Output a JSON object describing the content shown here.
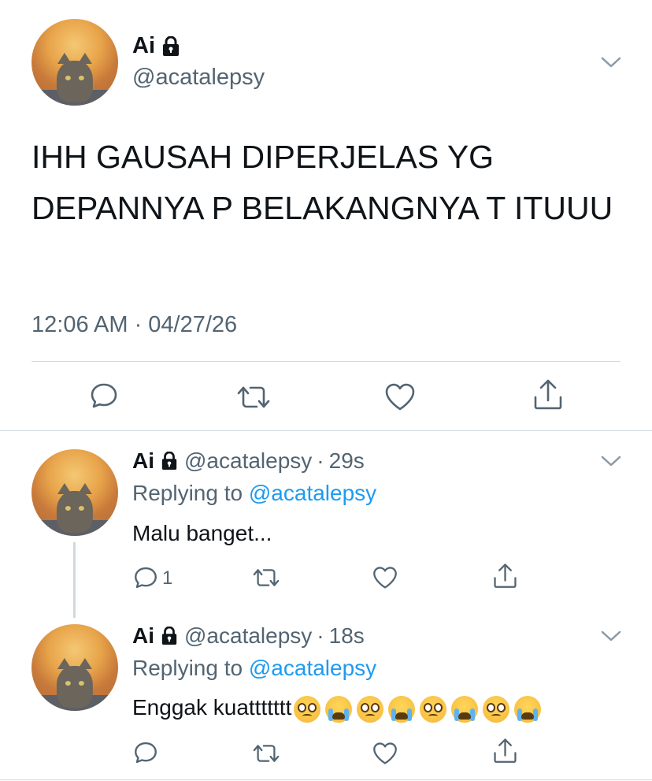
{
  "main_tweet": {
    "name": "Ai",
    "handle": "@acatalepsy",
    "text": "IHH GAUSAH DIPERJELAS YG DEPANNYA P BELAKANGNYA T ITUUU",
    "timestamp": "12:06 AM · 04/27/26",
    "icons": [
      "lock-icon",
      "chevron-down-icon",
      "reply-icon",
      "retweet-icon",
      "like-icon",
      "share-icon"
    ]
  },
  "replies": [
    {
      "name": "Ai",
      "handle": "@acatalepsy",
      "time": "29s",
      "replying_prefix": "Replying to",
      "replying_mention": "@acatalepsy",
      "text": "Malu banget...",
      "reply_count": "1"
    },
    {
      "name": "Ai",
      "handle": "@acatalepsy",
      "time": "18s",
      "replying_prefix": "Replying to",
      "replying_mention": "@acatalepsy",
      "text": "Enggak kuattttttt",
      "emojis": [
        "pleading-face",
        "loudly-crying-face",
        "pleading-face",
        "loudly-crying-face",
        "pleading-face",
        "loudly-crying-face",
        "pleading-face",
        "loudly-crying-face"
      ]
    }
  ],
  "colors": {
    "text": "#0f1419",
    "secondary": "#536471",
    "link": "#1d9bf0",
    "divider": "#cfd9de"
  }
}
